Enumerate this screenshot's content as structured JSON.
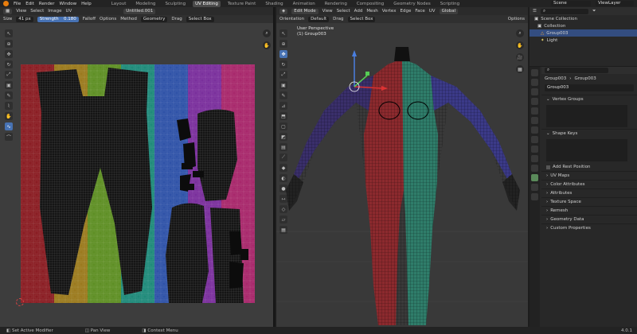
{
  "menubar": {
    "menus": [
      "File",
      "Edit",
      "Render",
      "Window",
      "Help"
    ],
    "workspaces": [
      "Layout",
      "Modeling",
      "Sculpting",
      "UV Editing",
      "Texture Paint",
      "Shading",
      "Animation",
      "Rendering",
      "Compositing",
      "Geometry Nodes",
      "Scripting"
    ],
    "active_workspace": "UV Editing",
    "scene": "Scene",
    "view_layer": "ViewLayer"
  },
  "uv_editor": {
    "menus": [
      "View",
      "Select",
      "Image",
      "UV"
    ],
    "image_name": "Untitled.001",
    "tool_settings": {
      "size_label": "Size",
      "size_value": "41 px",
      "strength_label": "Strength",
      "strength_value": "0.180",
      "falloff": "Falloff",
      "options": "Options",
      "method_label": "Method",
      "method_value": "Geometry",
      "drag_label": "Drag",
      "drag_value": "Select Box"
    },
    "texture_colors": [
      "#8a1d23",
      "#9b7a1e",
      "#5e8f24",
      "#1f8a7a",
      "#2f52a8",
      "#7a2f9c",
      "#a8286b"
    ]
  },
  "viewport": {
    "mode": "Edit Mode",
    "menus": [
      "View",
      "Select",
      "Add",
      "Mesh",
      "Vertex",
      "Edge",
      "Face",
      "UV"
    ],
    "orientation_label": "Orientation",
    "orientation_value": "Default",
    "drag_label": "Drag",
    "drag_value": "Select Box",
    "transform": "Global",
    "options": "Options",
    "view_name": "User Perspective",
    "object_name": "(1) Group003"
  },
  "outliner": {
    "items": [
      {
        "label": "Scene Collection"
      },
      {
        "label": "Collection"
      },
      {
        "label": "Group003"
      },
      {
        "label": "Light"
      }
    ]
  },
  "properties": {
    "breadcrumb": [
      "Group003",
      "Group003"
    ],
    "data_name": "Group003",
    "sections": {
      "vertex_groups": "Vertex Groups",
      "shape_keys": "Shape Keys",
      "add_rest": "Add Rest Position",
      "uv_maps": "UV Maps",
      "color_attributes": "Color Attributes",
      "attributes": "Attributes",
      "texture_space": "Texture Space",
      "remesh": "Remesh",
      "geometry_data": "Geometry Data",
      "custom_properties": "Custom Properties"
    }
  },
  "status": {
    "left": "Set Active Modifier",
    "mid": "Pan View",
    "right": "Context Menu",
    "version": "4.0.1"
  }
}
